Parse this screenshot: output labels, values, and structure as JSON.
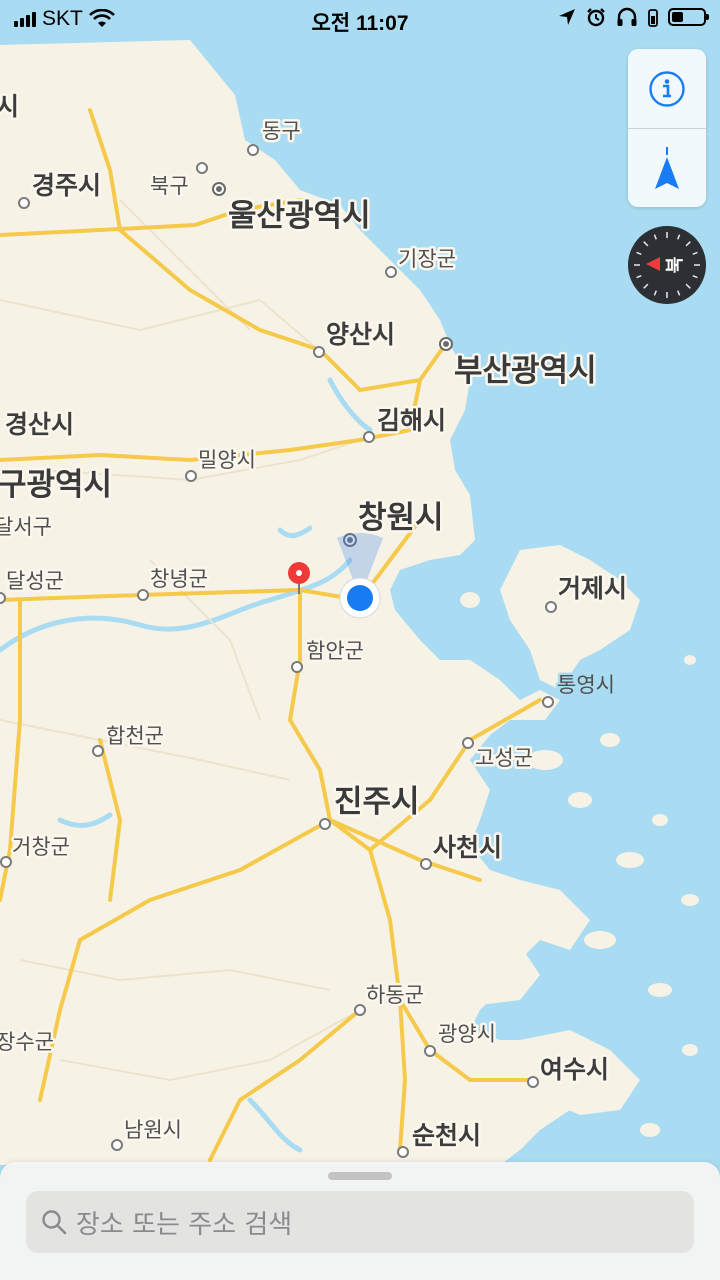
{
  "status_bar": {
    "carrier": "SKT",
    "time": "오전 11:07",
    "battery_level": 0.35
  },
  "map": {
    "labels": {
      "ulsan_partial": "시",
      "donggu": "동구",
      "gyeongju": "경주시",
      "bukgu": "북구",
      "ulsan": "울산광역시",
      "gijang": "기장군",
      "yangsan": "양산시",
      "busan": "부산광역시",
      "gyeongsan": "경산시",
      "gimhae": "김해시",
      "miryang": "밀양시",
      "daegu": "구광역시",
      "dalseo": "달서구",
      "changwon": "창원시",
      "dalseong": "달성군",
      "changnyeong": "창녕군",
      "geoje": "거제시",
      "haman": "함안군",
      "tongyeong": "통영시",
      "hapcheon": "합천군",
      "goseong": "고성군",
      "jinju": "진주시",
      "sacheon": "사천시",
      "geochang": "거창군",
      "hadong": "하동군",
      "gwangyang": "광양시",
      "jangsu": "장수군",
      "yeosu": "여수시",
      "namwon": "남원시",
      "suncheon": "순천시"
    }
  },
  "controls": {
    "info_icon": "info-icon",
    "tracking_icon": "location-arrow-icon",
    "compass_label": "북"
  },
  "search": {
    "placeholder": "장소 또는 주소 검색"
  },
  "colors": {
    "sea": "#a9dcf2",
    "land": "#f6f2e6",
    "road": "#f5c94a",
    "accent": "#1a7cf5",
    "pin": "#f03a3a"
  }
}
